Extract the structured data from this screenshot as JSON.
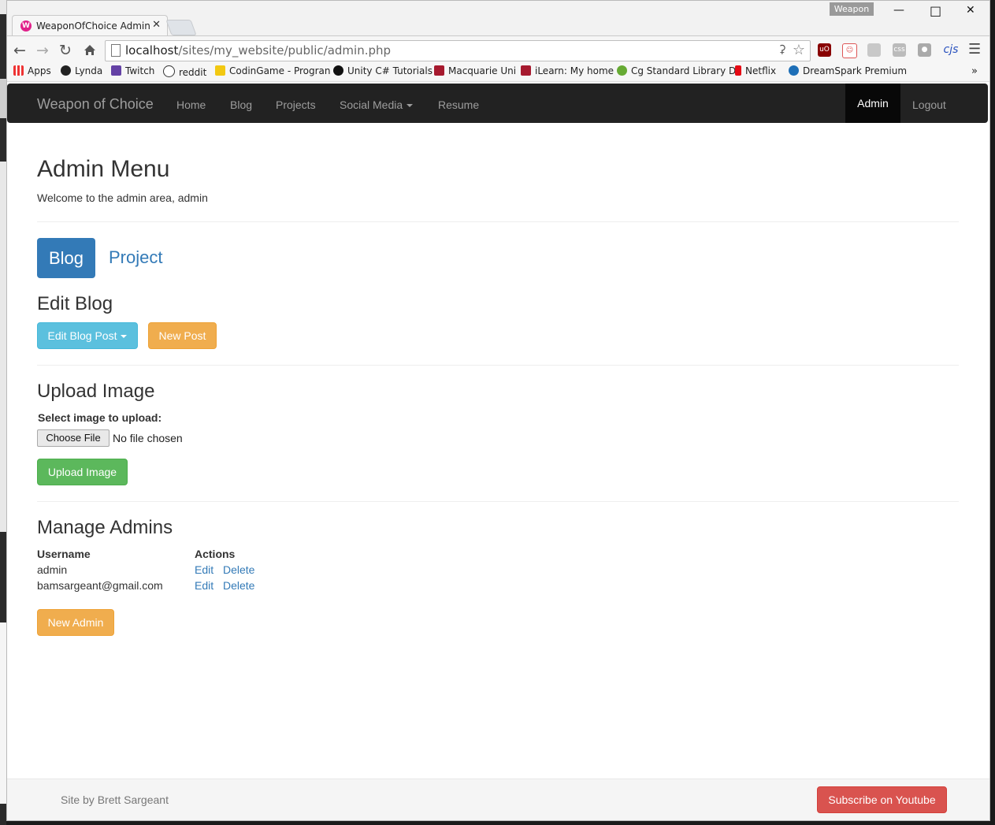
{
  "browser": {
    "tab_title": "WeaponOfChoice Admin",
    "tab_favicon": "W",
    "window_badge": "Weapon",
    "url_host": "localhost",
    "url_path": "/sites/my_website/public/admin.php",
    "extensions": [
      "uO",
      "cjs"
    ],
    "bookmarks": [
      "Apps",
      "Lynda",
      "Twitch",
      "reddit",
      "CodinGame - Progran",
      "Unity C# Tutorials",
      "Macquarie Uni",
      "iLearn: My home",
      "Cg Standard Library D",
      "Netflix",
      "DreamSpark Premium"
    ]
  },
  "navbar": {
    "brand": "Weapon of Choice",
    "links": [
      "Home",
      "Blog",
      "Projects",
      "Social Media",
      "Resume"
    ],
    "active": "Admin",
    "logout": "Logout"
  },
  "main": {
    "title": "Admin Menu",
    "welcome": "Welcome to the admin area, admin",
    "pills": [
      "Blog",
      "Project"
    ],
    "edit_blog": {
      "heading": "Edit Blog",
      "edit_button": "Edit Blog Post",
      "new_button": "New Post"
    },
    "upload": {
      "heading": "Upload Image",
      "label": "Select image to upload:",
      "choose_button": "Choose File",
      "file_status": "No file chosen",
      "submit": "Upload Image"
    },
    "admins": {
      "heading": "Manage Admins",
      "columns": [
        "Username",
        "Actions"
      ],
      "rows": [
        {
          "username": "admin",
          "edit": "Edit",
          "delete": "Delete"
        },
        {
          "username": "bamsargeant@gmail.com",
          "edit": "Edit",
          "delete": "Delete"
        }
      ],
      "new_button": "New Admin"
    }
  },
  "footer": {
    "credit": "Site by Brett Sargeant",
    "youtube_button": "Subscribe on Youtube"
  },
  "colors": {
    "primary": "#337ab7",
    "info": "#5bc0de",
    "warning": "#f0ad4e",
    "success": "#5cb85c",
    "danger": "#d9534f",
    "navbar": "#222222"
  }
}
